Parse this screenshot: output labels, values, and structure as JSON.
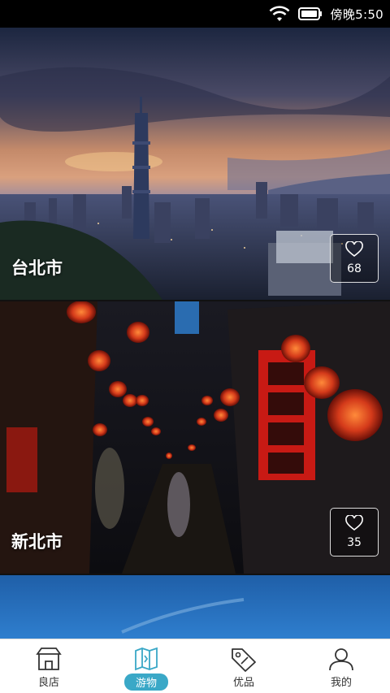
{
  "status": {
    "carrier_label": "傍晚",
    "time": "5:50",
    "time_full": "傍晚5:50"
  },
  "feed": {
    "cards": [
      {
        "city": "台北市",
        "likes": "68",
        "image": "taipei-skyline-sunset"
      },
      {
        "city": "新北市",
        "likes": "35",
        "image": "jiufen-red-lanterns"
      },
      {
        "city": "",
        "likes": "",
        "image": "blue-sky-partial"
      }
    ]
  },
  "tabs": [
    {
      "label": "良店",
      "icon": "shop-icon",
      "active": false
    },
    {
      "label": "游物",
      "icon": "travel-map-icon",
      "active": true
    },
    {
      "label": "优品",
      "icon": "tag-icon",
      "active": false
    },
    {
      "label": "我的",
      "icon": "user-icon",
      "active": false
    }
  ],
  "colors": {
    "accent": "#3aa8c7",
    "tab_bar_bg": "#ffffff",
    "status_bar_bg": "#000000"
  }
}
